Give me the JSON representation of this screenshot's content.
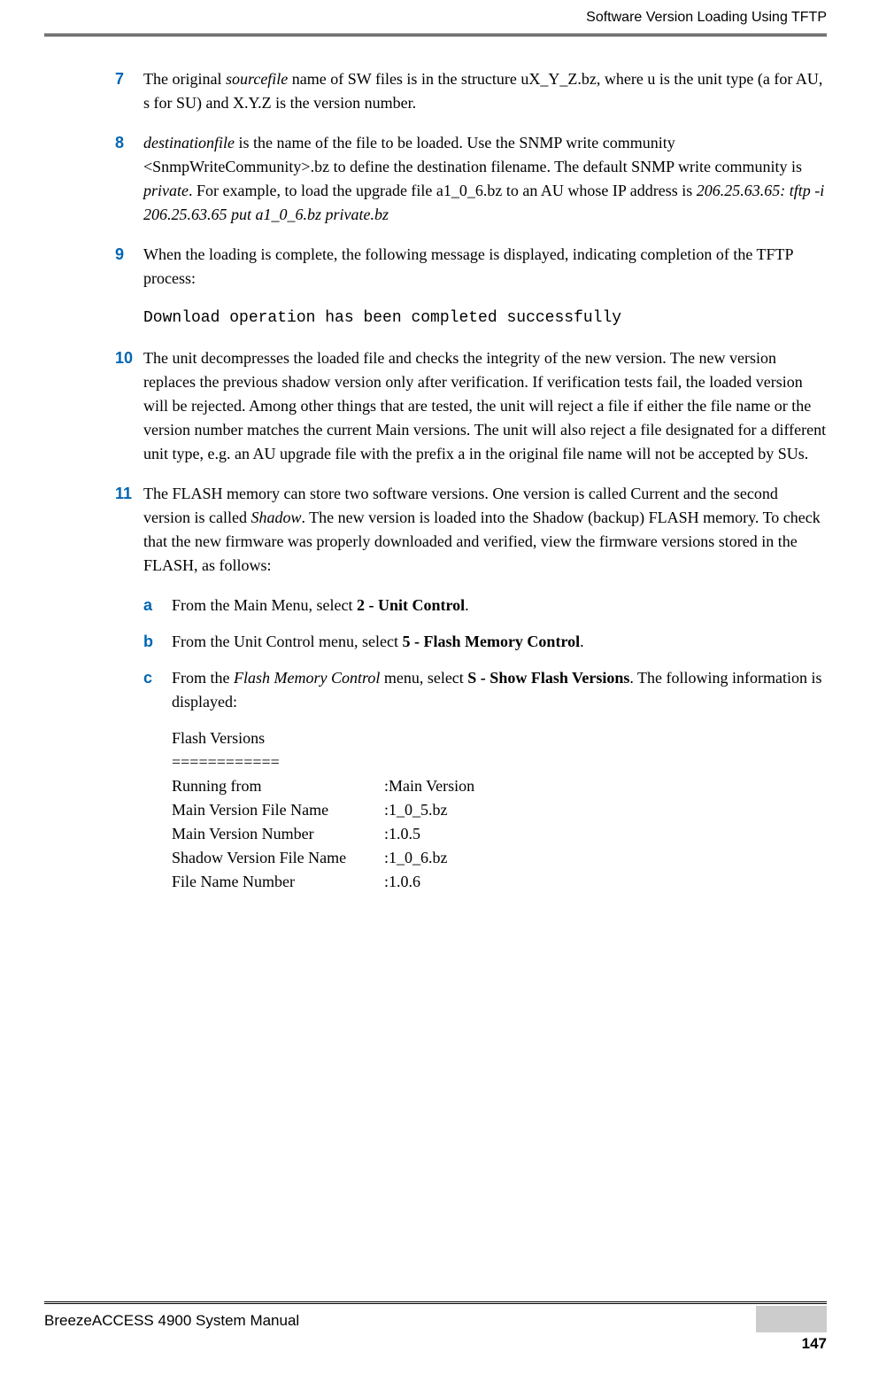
{
  "header": {
    "title": "Software Version Loading Using TFTP"
  },
  "items": {
    "i7": {
      "num": "7",
      "text_before": "The original ",
      "sourcefile": "sourcefile",
      "text_after": " name of SW files is in the structure uX_Y_Z.bz, where u is the unit type (a for AU, s for SU) and X.Y.Z is the version number."
    },
    "i8": {
      "num": "8",
      "destfile": " destinationfile",
      "text1": " is the name of the file to be loaded. Use the SNMP write community <SnmpWriteCommunity>.bz to define the destination filename. The default SNMP write community is ",
      "private": "private",
      "text2": ". For example, to load the upgrade file a1_0_6.bz to an AU whose IP address is ",
      "cmd": "206.25.63.65: tftp -i 206.25.63.65 put a1_0_6.bz private.bz"
    },
    "i9": {
      "num": "9",
      "text": "When the loading is complete, the following message is displayed, indicating completion of the TFTP process:",
      "code": "Download operation has been completed successfully"
    },
    "i10": {
      "num": "10",
      "text": "The unit decompresses the loaded file and checks the integrity of the new version. The new version replaces the previous shadow version only after verification. If verification tests fail, the loaded version will be rejected. Among other things that are tested, the unit will reject a file if either the file name or the version number matches the current Main versions. The unit will also reject a file designated for a different unit type, e.g. an AU upgrade file with the prefix a in the original file name will not be accepted by SUs."
    },
    "i11": {
      "num": "11",
      "text1": "The FLASH memory can store two software versions. One version is called Current and the second version is called ",
      "shadow": "Shadow",
      "text2": ". The new version is loaded into the Shadow (backup) FLASH memory. To check that the new firmware was properly downloaded and verified, view the firmware versions stored in the FLASH, as follows:"
    },
    "sub": {
      "a": {
        "letter": "a",
        "text1": "From the Main Menu, select ",
        "bold": "2 - Unit Control",
        "text2": "."
      },
      "b": {
        "letter": "b",
        "text1": "From the Unit Control menu, select ",
        "bold": "5 - Flash Memory Control",
        "text2": "."
      },
      "c": {
        "letter": "c",
        "text1": "From the ",
        "italic": "Flash Memory Control",
        "text2": " menu, select ",
        "bold": "S - Show Flash Versions",
        "text3": ". The following information is displayed:"
      }
    },
    "flash": {
      "title": "Flash Versions",
      "divider": "============",
      "rows": [
        {
          "label": "Running from",
          "value": ":Main Version"
        },
        {
          "label": "Main Version File Name",
          "value": ":1_0_5.bz"
        },
        {
          "label": "Main Version Number",
          "value": ":1.0.5"
        },
        {
          "label": "Shadow Version File Name",
          "value": ":1_0_6.bz"
        },
        {
          "label": "File Name Number",
          "value": ":1.0.6"
        }
      ]
    }
  },
  "footer": {
    "manual": "BreezeACCESS 4900 System Manual",
    "page": "147"
  }
}
